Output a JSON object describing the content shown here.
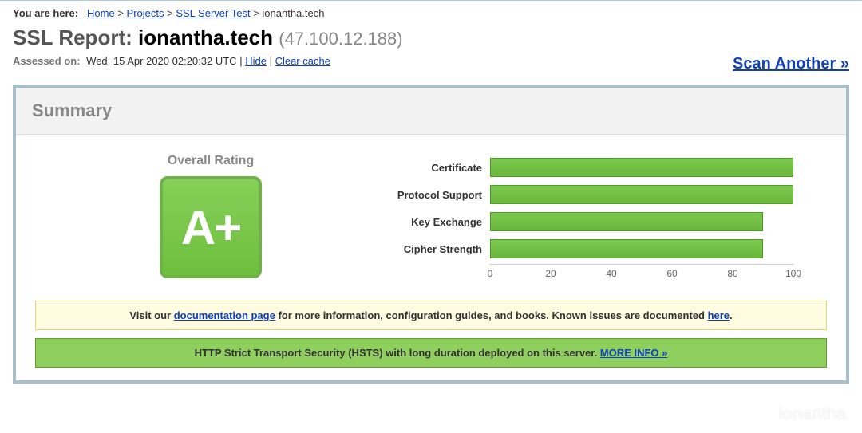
{
  "breadcrumb": {
    "label": "You are here:",
    "items": [
      {
        "text": "Home",
        "link": true
      },
      {
        "text": "Projects",
        "link": true
      },
      {
        "text": "SSL Server Test",
        "link": true
      },
      {
        "text": "ionantha.tech",
        "link": false
      }
    ]
  },
  "heading": {
    "prefix": "SSL Report:",
    "domain": "ionantha.tech",
    "ip": "(47.100.12.188)"
  },
  "assessed": {
    "label": "Assessed on:",
    "timestamp": "Wed, 15 Apr 2020 02:20:32 UTC",
    "hide": "Hide",
    "clear": "Clear cache"
  },
  "scan_another": "Scan Another »",
  "summary_title": "Summary",
  "rating": {
    "title": "Overall Rating",
    "grade": "A+"
  },
  "chart_data": {
    "type": "bar",
    "categories": [
      "Certificate",
      "Protocol Support",
      "Key Exchange",
      "Cipher Strength"
    ],
    "values": [
      100,
      100,
      90,
      90
    ],
    "xlim": [
      0,
      100
    ],
    "ticks": [
      0,
      20,
      40,
      60,
      80,
      100
    ]
  },
  "notice_docs": {
    "pre": "Visit our ",
    "link1": "documentation page",
    "mid": " for more information, configuration guides, and books. Known issues are documented ",
    "link2": "here",
    "post": "."
  },
  "notice_hsts": {
    "text": "HTTP Strict Transport Security (HSTS) with long duration deployed on this server.  ",
    "link": "MORE INFO »"
  },
  "watermark": "ionantha"
}
